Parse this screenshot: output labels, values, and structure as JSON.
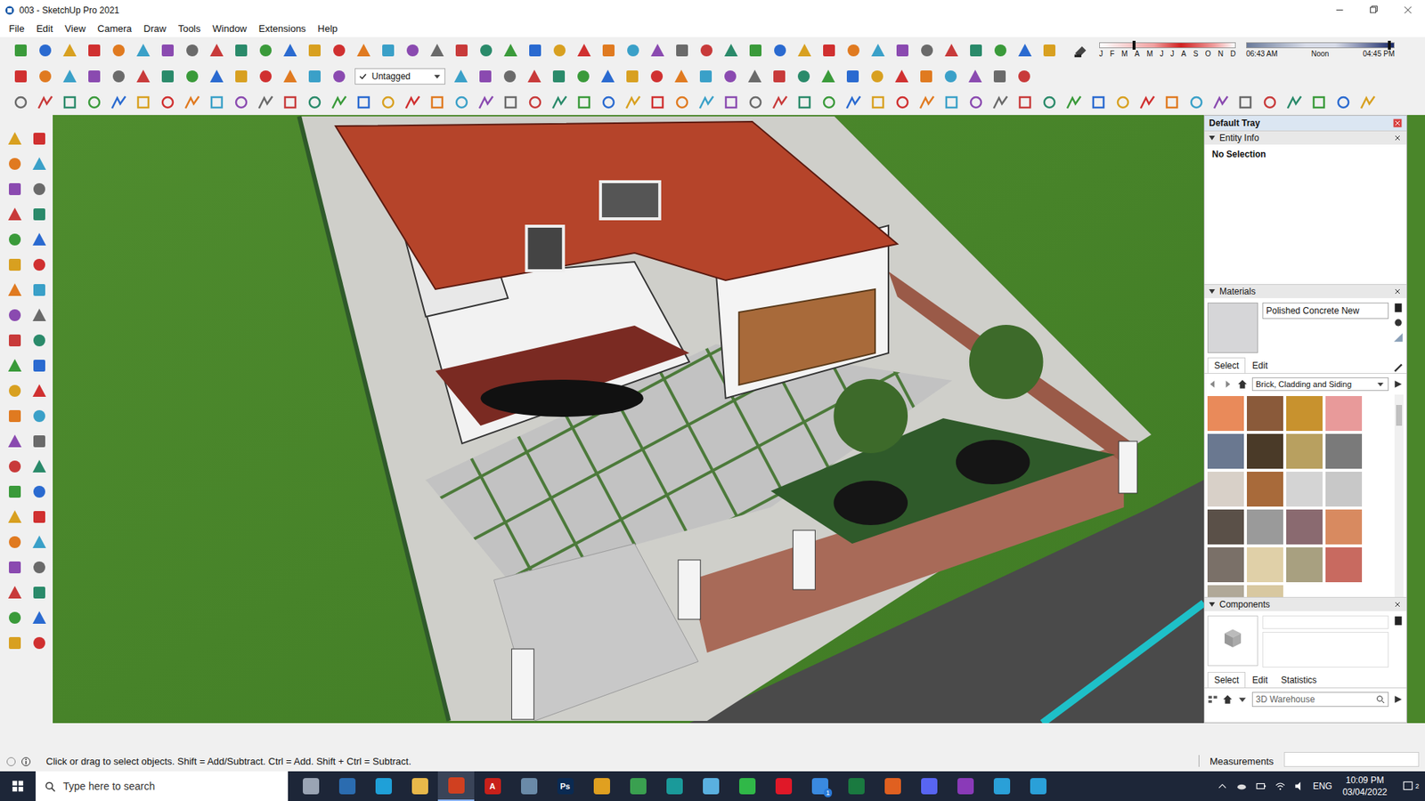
{
  "window": {
    "title": "003 - SketchUp Pro 2021"
  },
  "menu": [
    "File",
    "Edit",
    "View",
    "Camera",
    "Draw",
    "Tools",
    "Window",
    "Extensions",
    "Help"
  ],
  "shadow": {
    "months": [
      "J",
      "F",
      "M",
      "A",
      "M",
      "J",
      "J",
      "A",
      "S",
      "O",
      "N",
      "D"
    ],
    "month_level": 0.25,
    "times": [
      "06:43 AM",
      "Noon",
      "04:45 PM"
    ],
    "time_level": 0.97
  },
  "tag_dropdown": {
    "value": "Untagged"
  },
  "tray": {
    "title": "Default Tray",
    "entity_info": {
      "title": "Entity Info",
      "value": "No Selection"
    },
    "materials": {
      "title": "Materials",
      "name": "Polished Concrete New",
      "tabs": [
        {
          "label": "Select",
          "selected": true
        },
        {
          "label": "Edit",
          "selected": false
        }
      ],
      "library": "Brick, Cladding and Siding",
      "swatches": [
        {
          "color": "#e98a5a"
        },
        {
          "color": "#8a5a3a"
        },
        {
          "color": "#c8922e"
        },
        {
          "color": "#e89a9a"
        },
        {
          "color": "#6a7890"
        },
        {
          "color": "#4a3a28"
        },
        {
          "color": "#b8a060"
        },
        {
          "color": "#7a7a7a"
        },
        {
          "color": "#d8d0c8"
        },
        {
          "color": "#a86a3a"
        },
        {
          "color": "#d4d4d4"
        },
        {
          "color": "#c8c8c8"
        },
        {
          "color": "#5a5048"
        },
        {
          "color": "#9a9a9a"
        },
        {
          "color": "#8a6a70"
        },
        {
          "color": "#d88a60"
        },
        {
          "color": "#7a7068"
        },
        {
          "color": "#e0d0a8"
        },
        {
          "color": "#a8a080"
        },
        {
          "color": "#c86a60"
        },
        {
          "color": "#b0a898"
        },
        {
          "color": "#d8c8a0"
        }
      ]
    },
    "components": {
      "title": "Components",
      "tabs": [
        {
          "label": "Select",
          "selected": true
        },
        {
          "label": "Edit",
          "selected": false
        },
        {
          "label": "Statistics",
          "selected": false
        }
      ],
      "search_placeholder": "3D Warehouse"
    }
  },
  "status_bar": {
    "message": "Click or drag to select objects. Shift = Add/Subtract. Ctrl = Add. Shift + Ctrl = Subtract.",
    "measurements_label": "Measurements"
  },
  "taskbar": {
    "search_placeholder": "Type here to search",
    "language": "ENG",
    "time": "10:09 PM",
    "date": "03/04/2022",
    "notifications": "2",
    "apps": [
      {
        "color": "#9aa4b4",
        "active": false
      },
      {
        "color": "#2b6cb0",
        "active": false
      },
      {
        "color": "#1fa0d8",
        "active": false
      },
      {
        "color": "#e8b84a",
        "active": false
      },
      {
        "color": "#d04020",
        "active": true
      },
      {
        "color": "#c8201a",
        "active": false,
        "label": "A"
      },
      {
        "color": "#6a8aa8",
        "active": false
      },
      {
        "color": "#0a2a52",
        "active": false,
        "label": "Ps"
      },
      {
        "color": "#e0a020",
        "active": false
      },
      {
        "color": "#3aa050",
        "active": false
      },
      {
        "color": "#1a9a9a",
        "active": false
      },
      {
        "color": "#5ab0e0",
        "active": false
      },
      {
        "color": "#30b848",
        "active": false
      },
      {
        "color": "#e01828",
        "active": false
      },
      {
        "color": "#3a8ae0",
        "active": false,
        "badge": "1"
      },
      {
        "color": "#1a7a40",
        "active": false
      },
      {
        "color": "#e06020",
        "active": false
      },
      {
        "color": "#5865f2",
        "active": false
      },
      {
        "color": "#8a3ab8",
        "active": false
      },
      {
        "color": "#2aa0d8",
        "active": false
      },
      {
        "color": "#2aa0d8",
        "active": false
      }
    ]
  }
}
